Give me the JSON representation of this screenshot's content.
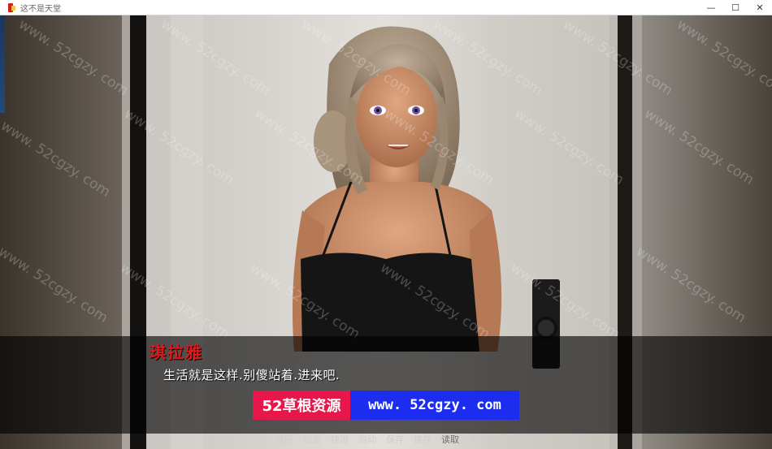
{
  "window": {
    "title": "这不是天堂",
    "controls": {
      "minimize": "—",
      "maximize": "☐",
      "close": "✕"
    }
  },
  "dialog": {
    "speaker": "琪拉雅",
    "text": "生活就是这样.别傻站着.进来吧."
  },
  "banner": {
    "site_name": "52草根资源",
    "site_url": "www. 52cgzy. com"
  },
  "quick_menu": [
    {
      "label": "返回",
      "enabled": true
    },
    {
      "label": "记录",
      "enabled": true
    },
    {
      "label": "快进",
      "enabled": true
    },
    {
      "label": "自动",
      "enabled": true
    },
    {
      "label": "保存",
      "enabled": true
    },
    {
      "label": "快存",
      "enabled": true
    },
    {
      "label": "读取",
      "enabled": false
    },
    {
      "label": "菜单",
      "enabled": true
    }
  ],
  "watermark": "www. 52cgzy. com",
  "colors": {
    "speaker": "#e0191b",
    "banner_left": "#e8174b",
    "banner_right": "#1c2df0"
  }
}
